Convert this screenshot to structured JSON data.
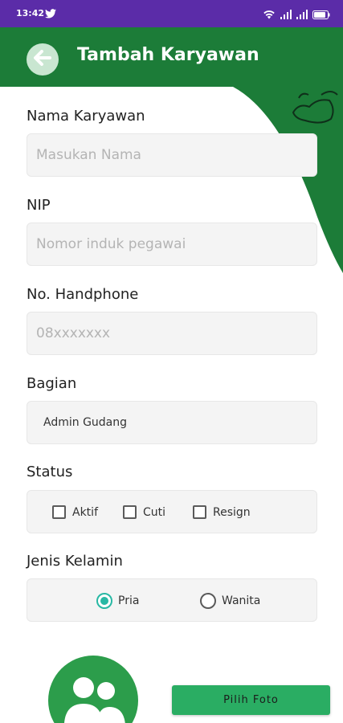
{
  "status_bar": {
    "time": "13:42"
  },
  "app_bar": {
    "title": "Tambah Karyawan"
  },
  "form": {
    "nama": {
      "label": "Nama Karyawan",
      "placeholder": "Masukan Nama",
      "value": ""
    },
    "nip": {
      "label": "NIP",
      "placeholder": "Nomor induk pegawai",
      "value": ""
    },
    "handphone": {
      "label": "No. Handphone",
      "placeholder": "08xxxxxxx",
      "value": ""
    },
    "bagian": {
      "label": "Bagian",
      "value": "Admin Gudang"
    },
    "status": {
      "label": "Status",
      "options": [
        {
          "label": "Aktif",
          "checked": false
        },
        {
          "label": "Cuti",
          "checked": false
        },
        {
          "label": "Resign",
          "checked": false
        }
      ]
    },
    "jenis_kelamin": {
      "label": "Jenis Kelamin",
      "options": [
        {
          "label": "Pria",
          "selected": true
        },
        {
          "label": "Wanita",
          "selected": false
        }
      ]
    }
  },
  "photo": {
    "button_label": "Pilih Foto"
  },
  "colors": {
    "status_bar": "#5b2ca8",
    "primary": "#1c7c38",
    "button": "#2aad63",
    "radio_selected": "#28b8a4"
  },
  "icons": [
    "twitter-icon",
    "wifi-icon",
    "signal-icon",
    "battery-icon",
    "arrow-left-icon",
    "users-icon"
  ]
}
